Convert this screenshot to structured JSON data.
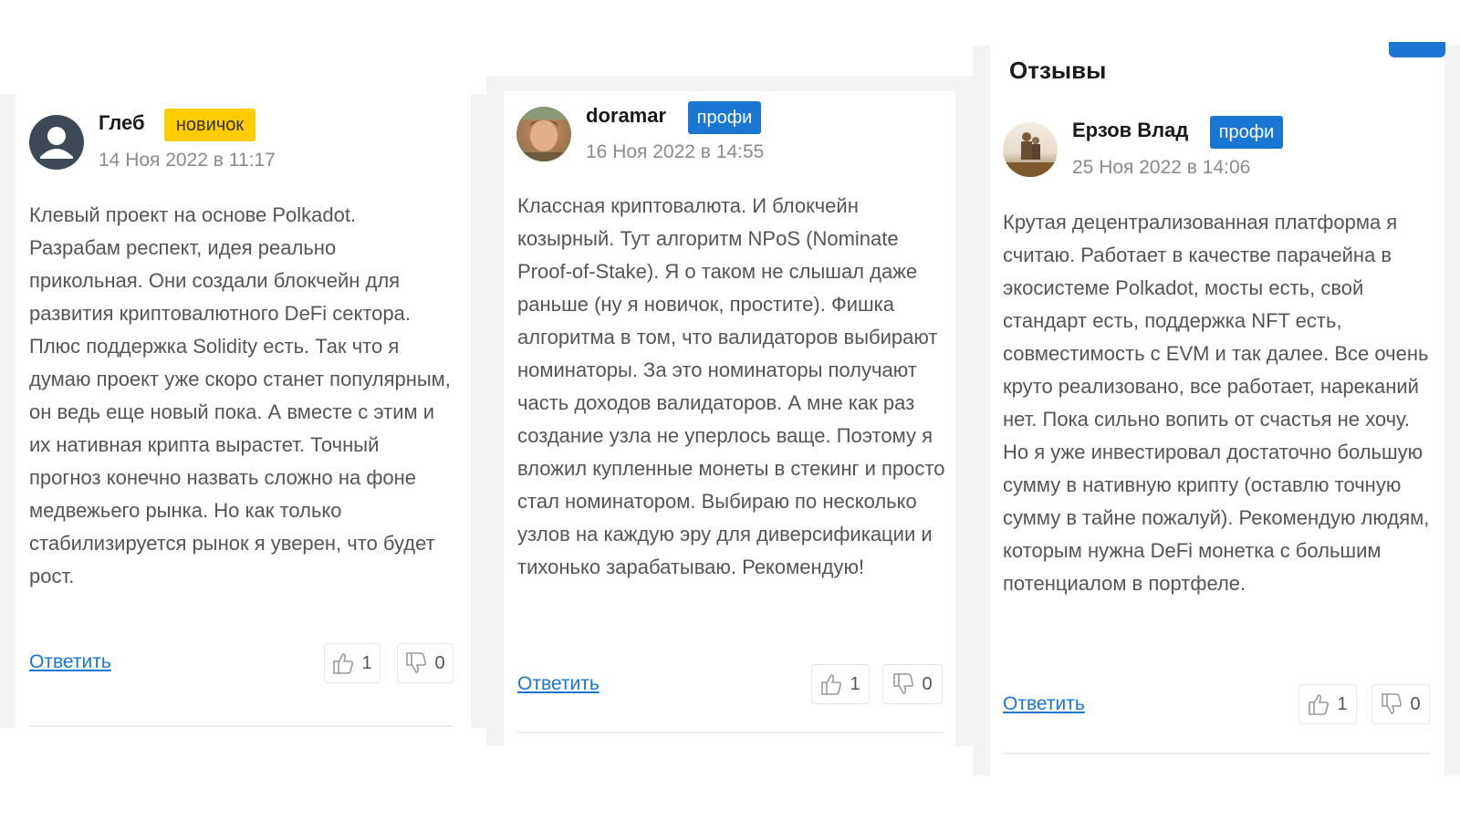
{
  "section_title": "Отзывы",
  "reviews": [
    {
      "author": "Глеб",
      "badge": "новичок",
      "date": "14 Ноя 2022 в 11:17",
      "avatar": "user-silhouette-icon",
      "text": "Клевый проект на основе Polkadot. Разрабам респект, идея реально прикольная. Они создали блокчейн для развития криптовалютного DeFi сектора. Плюс поддержка Solidity есть. Так что я думаю проект уже скоро станет популярным, он ведь еще новый пока. А вместе с этим и их нативная крипта вырастет. Точный прогноз конечно назвать сложно на фоне медвежьего рынка. Но как только стабилизируется рынок я уверен, что будет рост.",
      "reply_label": "Ответить",
      "likes": "1",
      "dislikes": "0"
    },
    {
      "author": "doramar",
      "badge": "профи",
      "date": "16 Ноя 2022 в 14:55",
      "avatar": "photo-avatar",
      "text": "Классная криптовалюта. И блокчейн козырный. Тут алгоритм NPoS (Nominate Proof-of-Stake). Я о таком не слышал даже раньше (ну я новичок, простите). Фишка алгоритма в том, что валидаторов выбирают номинаторы. За это номинаторы получают часть доходов валидаторов. А мне как раз создание узла не уперлось ваще. Поэтому я вложил купленные монеты в стекинг и просто стал номинатором. Выбираю по несколько узлов на каждую эру для диверсификации и тихонько зарабатываю. Рекомендую!",
      "reply_label": "Ответить",
      "likes": "1",
      "dislikes": "0"
    },
    {
      "author": "Ерзов Влад",
      "badge": "профи",
      "date": "25 Ноя 2022 в 14:06",
      "avatar": "photo-avatar",
      "text": "Крутая децентрализованная платформа я считаю. Работает в качестве парачейна в экосистеме Polkadot, мосты есть, свой стандарт есть, поддержка NFT есть, совместимость с EVM и так далее. Все очень круто реализовано, все работает, нареканий нет. Пока сильно вопить от счастья не хочу. Но я уже инвестировал достаточно большую сумму в нативную крипту (оставлю точную сумму в тайне пожалуй). Рекомендую людям, которым нужна DeFi монетка с большим потенциалом в портфеле.",
      "reply_label": "Ответить",
      "likes": "1",
      "dislikes": "0"
    }
  ],
  "colors": {
    "accent": "#1976d2",
    "newbie_badge": "#ffcc00",
    "text": "#555555",
    "muted": "#8a8a8a"
  }
}
